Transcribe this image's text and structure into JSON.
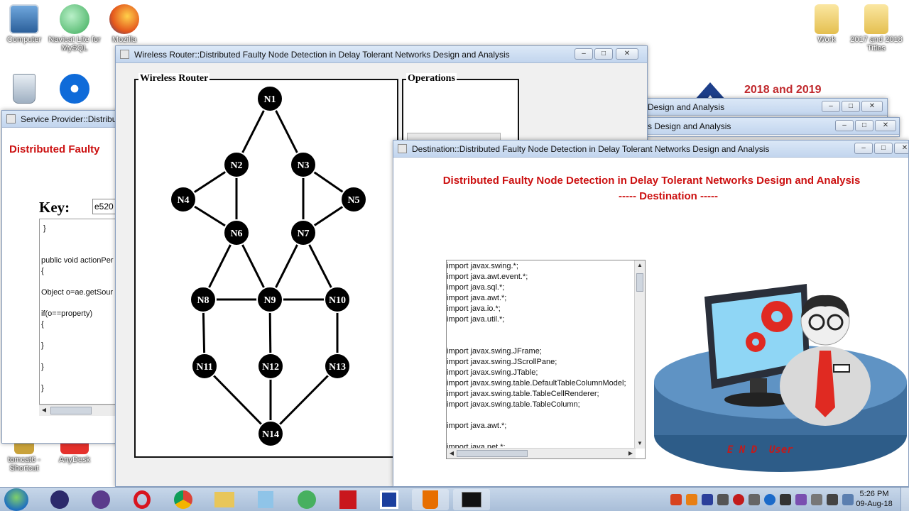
{
  "desktop": {
    "icons": [
      {
        "label": "Computer"
      },
      {
        "label": "Navicat Lite for MySQL"
      },
      {
        "label": "Mozilla"
      },
      {
        "label": "Work"
      },
      {
        "label": "2017 and 2018 Titles"
      },
      {
        "label": "tomcat6 - Shortcut"
      },
      {
        "label": "AnyDesk"
      }
    ],
    "banner_text": "2018 and 2019"
  },
  "service_provider": {
    "title": "Service Provider::Distribute",
    "heading": "Distributed Faulty",
    "key_label": "Key:",
    "key_value": "e520",
    "code": " }\n\n\npublic void actionPer\n{\n\nObject o=ae.getSour\n\nif(o==property)\n{\n\n}\n\n}\n\n}"
  },
  "back_windows": [
    {
      "title": "Design and Analysis"
    },
    {
      "title": "s Design and Analysis"
    }
  ],
  "router": {
    "title": "Wireless Router::Distributed Faulty Node Detection in Delay Tolerant Networks Design and Analysis",
    "panel_title": "Wireless Router",
    "operations_title": "Operations",
    "nodes": [
      "N1",
      "N2",
      "N3",
      "N4",
      "N5",
      "N6",
      "N7",
      "N8",
      "N9",
      "N10",
      "N11",
      "N12",
      "N13",
      "N14"
    ]
  },
  "destination": {
    "title": "Destination::Distributed Faulty Node Detection in Delay Tolerant Networks Design and Analysis",
    "heading_line1": "Distributed Faulty Node Detection in Delay Tolerant Networks Design and Analysis",
    "heading_line2": "----- Destination -----",
    "code": "import javax.swing.*;\nimport java.awt.event.*;\nimport java.sql.*;\nimport java.awt.*;\nimport java.io.*;\nimport java.util.*;\n\n\nimport javax.swing.JFrame;\nimport javax.swing.JScrollPane;\nimport javax.swing.JTable;\nimport javax.swing.table.DefaultTableColumnModel;\nimport javax.swing.table.TableCellRenderer;\nimport javax.swing.table.TableColumn;\n\nimport java.awt.*;\n\nimport java.net.*;",
    "end_user_label": "E N D  User"
  },
  "taskbar": {
    "time": "5:26 PM",
    "date": "09-Aug-18"
  },
  "colors": {
    "heading_red": "#cc1111",
    "titlebar": "#c9d9ef"
  }
}
